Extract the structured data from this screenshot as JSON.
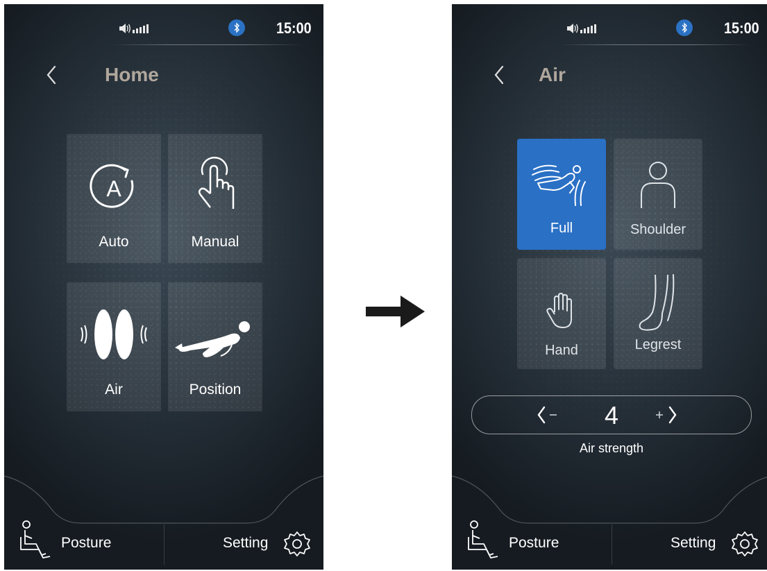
{
  "left_screen": {
    "status": {
      "time": "15:00",
      "signal_icon": "volume-signal-icon",
      "bluetooth_icon": "bluetooth-icon"
    },
    "title": "Home",
    "tiles": [
      {
        "label": "Auto",
        "icon": "auto-mode-icon"
      },
      {
        "label": "Manual",
        "icon": "hand-touch-icon"
      },
      {
        "label": "Air",
        "icon": "air-pressure-icon"
      },
      {
        "label": "Position",
        "icon": "reclining-person-icon"
      }
    ],
    "bottom_bar": {
      "posture_label": "Posture",
      "setting_label": "Setting"
    }
  },
  "right_screen": {
    "status": {
      "time": "15:00",
      "signal_icon": "volume-signal-icon",
      "bluetooth_icon": "bluetooth-icon"
    },
    "title": "Air",
    "tiles": [
      {
        "label": "Full",
        "icon": "full-body-air-icon",
        "selected": true
      },
      {
        "label": "Shoulder",
        "icon": "shoulder-icon",
        "selected": false
      },
      {
        "label": "Hand",
        "icon": "hand-icon",
        "selected": false
      },
      {
        "label": "Legrest",
        "icon": "leg-icon",
        "selected": false
      }
    ],
    "strength": {
      "value": "4",
      "label": "Air strength",
      "minus": "−",
      "plus": "+"
    },
    "bottom_bar": {
      "posture_label": "Posture",
      "setting_label": "Setting"
    }
  },
  "colors": {
    "accent": "#2a70c5",
    "bluetooth": "#2b72c4",
    "title": "#b0a79d",
    "background": "#263039"
  }
}
